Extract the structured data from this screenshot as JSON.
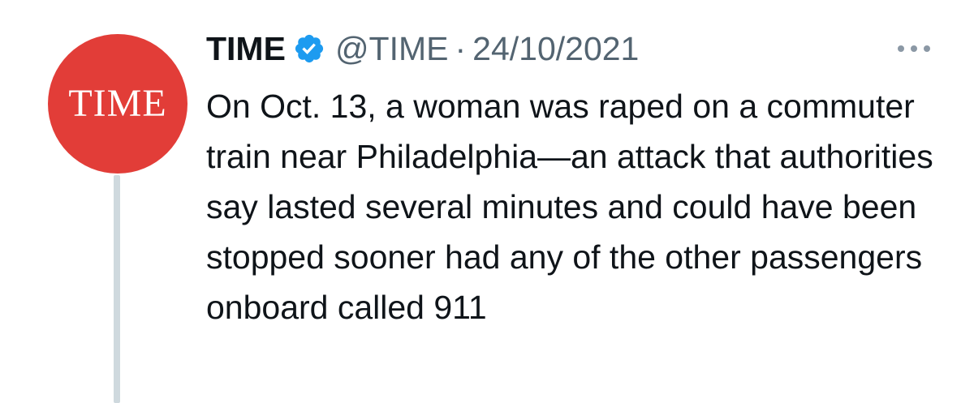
{
  "tweet": {
    "avatar": {
      "logo_text": "TIME",
      "background_color": "#e23d38"
    },
    "author": {
      "display_name": "TIME",
      "handle": "@TIME",
      "verified": true,
      "verified_color": "#1d9bf0"
    },
    "separator": "·",
    "date": "24/10/2021",
    "text": "On Oct. 13, a woman was raped on a commuter train near Philadelphia—an attack that authorities say lasted several minutes and could have been stopped sooner had any of the other passengers onboard called 911",
    "more_menu_icon": "more-horizontal-icon"
  }
}
